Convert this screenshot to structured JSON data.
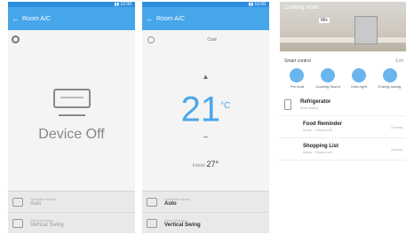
{
  "panel1": {
    "title": "Room A/C",
    "device_status": "Device Off",
    "mode": {
      "label": "Operation Mode",
      "value": "Auto"
    },
    "wind": {
      "label": "Wind Direction",
      "value": "Vertical Swing"
    }
  },
  "panel2": {
    "title": "Room A/C",
    "mode_label": "Cool",
    "up_arrow": "▲",
    "target_temp": "21",
    "unit": "°C",
    "down_arrow": "−",
    "current_label": "Indoor",
    "current_value": "27°",
    "mode": {
      "label": "Operation Mode",
      "value": "Auto"
    },
    "wind": {
      "label": "Wind Direction",
      "value": "Vertical Swing"
    }
  },
  "panel3": {
    "hero_title": "Cooking mode",
    "hero_tag": "Mix",
    "smart_title": "Smart control",
    "smart_more": "Edit",
    "modes": [
      {
        "label": "Pre heat"
      },
      {
        "label": "Cooking Sound"
      },
      {
        "label": "Oven light"
      },
      {
        "label": "Energy saving"
      }
    ],
    "fridge": {
      "name": "Refrigerator",
      "sub": "Auto status"
    },
    "items": [
      {
        "name": "Food Reminder",
        "sub": "Items · 4 items left",
        "right": "2 items"
      },
      {
        "name": "Shopping List",
        "sub": "Items · 3 items left",
        "right": "3 items"
      }
    ]
  }
}
